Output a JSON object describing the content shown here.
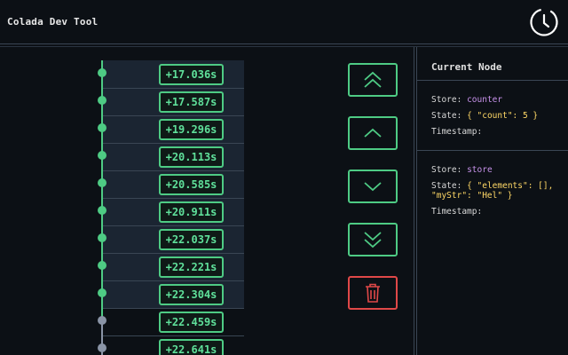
{
  "app": {
    "title": "Colada Dev Tool"
  },
  "timeline": {
    "entries": [
      {
        "time": "+17.036s",
        "active": true
      },
      {
        "time": "+17.587s",
        "active": true
      },
      {
        "time": "+19.296s",
        "active": true
      },
      {
        "time": "+20.113s",
        "active": true
      },
      {
        "time": "+20.585s",
        "active": true
      },
      {
        "time": "+20.911s",
        "active": true
      },
      {
        "time": "+22.037s",
        "active": true
      },
      {
        "time": "+22.221s",
        "active": true
      },
      {
        "time": "+22.304s",
        "active": true
      },
      {
        "time": "+22.459s",
        "active": false
      },
      {
        "time": "+22.641s",
        "active": false
      }
    ]
  },
  "controls": {
    "buttons": [
      "jump-to-first",
      "step-back",
      "step-forward",
      "jump-to-last",
      "delete"
    ]
  },
  "panel": {
    "title": "Current Node",
    "stores": [
      {
        "store_label": "Store:",
        "store_name": "counter",
        "state_label": "State:",
        "state_value": "{ \"count\": 5 }",
        "timestamp_label": "Timestamp:"
      },
      {
        "store_label": "Store:",
        "store_name": "store",
        "state_label": "State:",
        "state_value_line1": "{ \"elements\": [],",
        "state_value_line2": "\"myStr\": \"Hel\" }",
        "timestamp_label": "Timestamp:"
      }
    ]
  },
  "colors": {
    "accent": "#4ecb84",
    "danger": "#e04848",
    "background": "#0c1015",
    "store": "#c792ea",
    "state": "#ffd866"
  }
}
